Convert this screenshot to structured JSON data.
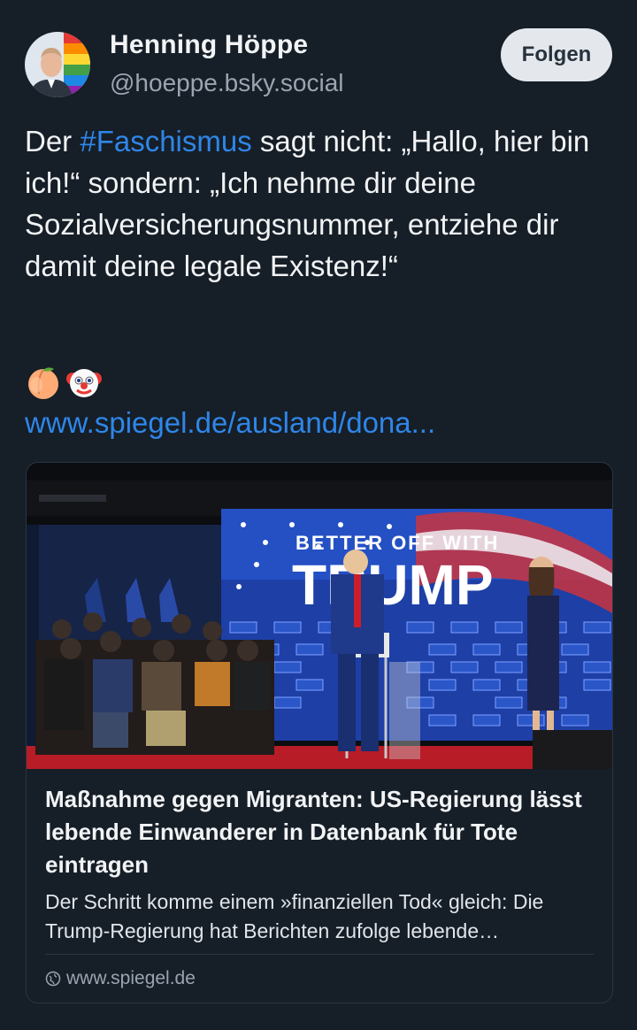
{
  "author": {
    "display_name": "Henning Höppe",
    "handle": "@hoeppe.bsky.social"
  },
  "follow_label": "Folgen",
  "post": {
    "text_before": "Der ",
    "hashtag": "#Faschismus",
    "text_after": " sagt nicht: „Hallo, hier bin ich!“ sondern: „Ich nehme dir deine Sozialversicherungsnummer, entziehe dir damit deine legale Existenz!“",
    "emojis": [
      "peach-emoji",
      "clown-face-emoji"
    ],
    "link_text": "www.spiegel.de/ausland/dona..."
  },
  "card": {
    "image_banner_line1": "BETTER OFF WITH",
    "image_banner_line2": "TRUMP",
    "title": "Maßnahme gegen Migranten: US-Regierung lässt lebende Einwanderer in Datenbank für Tote eintragen",
    "description": "Der Schritt komme einem »finanziellen Tod« gleich: Die Trump-Regierung hat Berichten zufolge lebende Einwanderer in eine Datenbank für Tote eintragen lassen.",
    "domain": "www.spiegel.de"
  },
  "colors": {
    "background": "#161e27",
    "link": "#2f86e8",
    "muted": "#9aa5b1"
  }
}
